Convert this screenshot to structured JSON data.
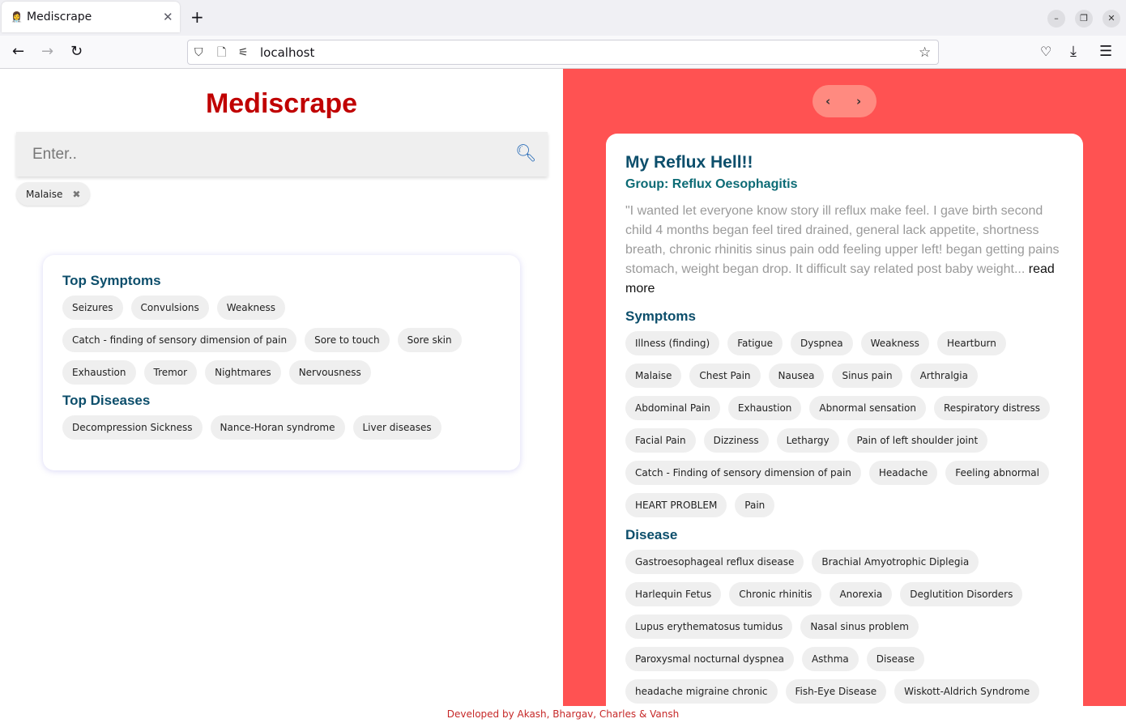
{
  "browser": {
    "tab_title": "Mediscrape",
    "url": "localhost"
  },
  "app": {
    "brand": "Mediscrape",
    "search_placeholder": "Enter..",
    "selected_chip": "Malaise",
    "top_symptoms_title": "Top Symptoms",
    "top_symptoms": [
      "Seizures",
      "Convulsions",
      "Weakness",
      "Catch - finding of sensory dimension of pain",
      "Sore to touch",
      "Sore skin",
      "Exhaustion",
      "Tremor",
      "Nightmares",
      "Nervousness"
    ],
    "top_diseases_title": "Top Diseases",
    "top_diseases": [
      "Decompression Sickness",
      "Nance-Horan syndrome",
      "Liver diseases"
    ]
  },
  "story": {
    "title": "My Reflux Hell!!",
    "group": "Group: Reflux Oesophagitis",
    "text": "\"I wanted let everyone know story ill reflux make feel. I gave birth second child 4 months began feel tired drained, general lack appetite, shortness breath, chronic rhinitis sinus pain odd feeling upper left! began getting pains stomach, weight began drop. It difficult say related post baby weight...",
    "read_more": "read more",
    "symptoms_title": "Symptoms",
    "symptoms": [
      "Illness (finding)",
      "Fatigue",
      "Dyspnea",
      "Weakness",
      "Heartburn",
      "Malaise",
      "Chest Pain",
      "Nausea",
      "Sinus pain",
      "Arthralgia",
      "Abdominal Pain",
      "Exhaustion",
      "Abnormal sensation",
      "Respiratory distress",
      "Facial Pain",
      "Dizziness",
      "Lethargy",
      "Pain of left shoulder joint",
      "Catch - Finding of sensory dimension of pain",
      "Headache",
      "Feeling abnormal",
      "HEART PROBLEM",
      "Pain"
    ],
    "disease_title": "Disease",
    "diseases": [
      "Gastroesophageal reflux disease",
      "Brachial Amyotrophic Diplegia",
      "Harlequin Fetus",
      "Chronic rhinitis",
      "Anorexia",
      "Deglutition Disorders",
      "Lupus erythematosus tumidus",
      "Nasal sinus problem",
      "Paroxysmal nocturnal dyspnea",
      "Asthma",
      "Disease",
      "headache migraine chronic",
      "Fish-Eye Disease",
      "Wiskott-Aldrich Syndrome"
    ]
  },
  "footer": "Developed by Akash, Bhargav, Charles & Vansh"
}
